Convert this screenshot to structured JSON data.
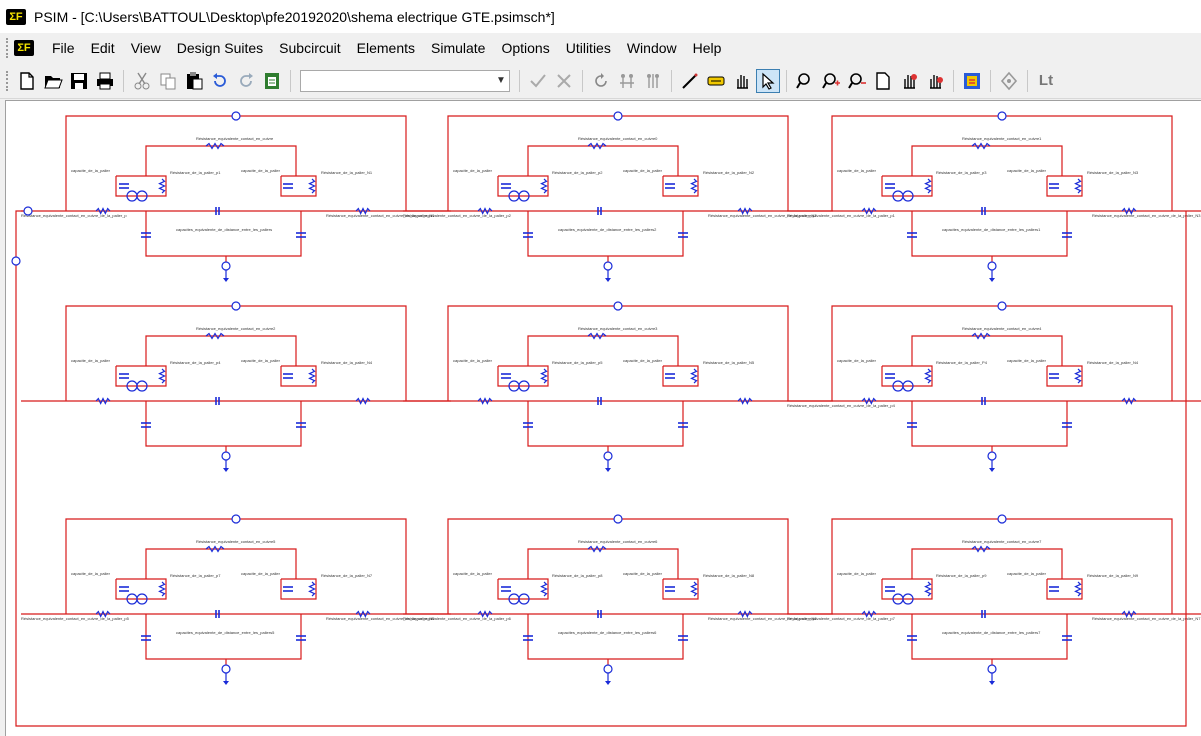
{
  "window": {
    "title": "PSIM - [C:\\Users\\BATTOUL\\Desktop\\pfe20192020\\shema electrique GTE.psimsch*]",
    "logo_text": "ΣF"
  },
  "menu": {
    "items": [
      "File",
      "Edit",
      "View",
      "Design Suites",
      "Subcircuit",
      "Elements",
      "Simulate",
      "Options",
      "Utilities",
      "Window",
      "Help"
    ]
  },
  "toolbar": {
    "combo_value": "",
    "lt_label": "Lt",
    "icons": [
      "new-icon",
      "open-icon",
      "save-icon",
      "print-icon",
      "cut-icon",
      "copy-icon",
      "paste-icon",
      "undo-icon",
      "redo-icon",
      "paste-special-icon",
      "check-icon",
      "cancel-icon",
      "rotate-icon",
      "flip-lr-icon",
      "flip-tb-icon",
      "wire-icon",
      "label-icon",
      "pan-icon",
      "select-icon",
      "zoom-icon",
      "zoom-in-icon",
      "zoom-out-icon",
      "fit-page-icon",
      "element-list-icon",
      "element-count-icon",
      "simcoder-icon",
      "probe-icon"
    ]
  },
  "schematic": {
    "columns": 3,
    "rows": 3,
    "blocks": [
      {
        "top_resistor": "Résistance_equivalente_contact_en_cuivre",
        "cap_left": "capacite_de_la_palier",
        "res_left": "Résistance_de_la_palier_p1",
        "cap_right": "capacite_de_la_palier",
        "res_right": "Résistance_de_la_palier_N1",
        "bottom_cap": "capacites_equivalente_de_distance_entre_les_paliers",
        "left_wire": "Résistance_equivalente_contact_en_cuivre_de_la_palier_p",
        "right_wire": "Résistance_equivalente_contact_en_cuivre_de_la_palier_N1"
      },
      {
        "top_resistor": "Résistance_equivalente_contact_en_cuivre0",
        "cap_left": "capacite_de_la_palier",
        "res_left": "Résistance_de_la_palier_p2",
        "cap_right": "capacite_de_la_palier",
        "res_right": "Résistance_de_la_palier_N2",
        "bottom_cap": "capacites_equivalente_de_distance_entre_les_paliers2",
        "left_wire": "Résistance_equivalente_contact_en_cuivre_de_la_palier_p2",
        "right_wire": "Résistance_equivalente_contact_en_cuivre_de_la_palier_N2"
      },
      {
        "top_resistor": "Résistance_equivalente_contact_en_cuivre1",
        "cap_left": "capacite_de_la_palier",
        "res_left": "Résistance_de_la_palier_p3",
        "cap_right": "capacite_de_la_palier",
        "res_right": "Résistance_de_la_palier_N3",
        "bottom_cap": "capacites_equivalente_de_distance_entre_les_paliers1",
        "left_wire": "Résistance_equivalente_contact_en_cuivre_de_la_palier_p1",
        "right_wire": "Résistance_equivalente_contact_en_cuivre_de_la_palier_N3"
      },
      {
        "top_resistor": "Résistance_equivalente_contact_en_cuivre2",
        "cap_left": "capacite_de_la_palier",
        "res_left": "Résistance_de_la_palier_p4",
        "cap_right": "capacite_de_la_palier",
        "res_right": "Résistance_de_la_palier_N4",
        "bottom_cap": "",
        "left_wire": "",
        "right_wire": ""
      },
      {
        "top_resistor": "Résistance_equivalente_contact_en_cuivre3",
        "cap_left": "capacite_de_la_palier",
        "res_left": "Résistance_de_la_palier_p5",
        "cap_right": "capacite_de_la_palier",
        "res_right": "Résistance_de_la_palier_N5",
        "bottom_cap": "",
        "left_wire": "",
        "right_wire": ""
      },
      {
        "top_resistor": "Résistance_equivalente_contact_en_cuivre4",
        "cap_left": "capacite_de_la_palier",
        "res_left": "Résistance_de_la_palier_P4",
        "cap_right": "capacite_de_la_palier",
        "res_right": "Résistance_de_la_palier_N4",
        "bottom_cap": "",
        "left_wire": "Résistance_equivalente_contact_en_cuivre_de_la_palier_p4",
        "right_wire": ""
      },
      {
        "top_resistor": "Résistance_equivalente_contact_en_cuivre5",
        "cap_left": "capacite_de_la_palier",
        "res_left": "Résistance_de_la_palier_p7",
        "cap_right": "capacite_de_la_palier",
        "res_right": "Résistance_de_la_palier_N7",
        "bottom_cap": "capacites_equivalente_de_distance_entre_les_paliers5",
        "left_wire": "Résistance_equivalente_contact_en_cuivre_de_la_palier_p5",
        "right_wire": "Résistance_equivalente_contact_en_cuivre_de_la_palier_N5"
      },
      {
        "top_resistor": "Résistance_equivalente_contact_en_cuivre6",
        "cap_left": "capacite_de_la_palier",
        "res_left": "Résistance_de_la_palier_p8",
        "cap_right": "capacite_de_la_palier",
        "res_right": "Résistance_de_la_palier_N8",
        "bottom_cap": "capacites_equivalente_de_distance_entre_les_paliers6",
        "left_wire": "Résistance_equivalente_contact_en_cuivre_de_la_palier_p6",
        "right_wire": "Résistance_equivalente_contact_en_cuivre_de_la_palier_N6"
      },
      {
        "top_resistor": "Résistance_equivalente_contact_en_cuivre7",
        "cap_left": "capacite_de_la_palier",
        "res_left": "Résistance_de_la_palier_p9",
        "cap_right": "capacite_de_la_palier",
        "res_right": "Résistance_de_la_palier_N9",
        "bottom_cap": "capacites_equivalente_de_distance_entre_les_paliers7",
        "left_wire": "Résistance_equivalente_contact_en_cuivre_de_la_palier_p7",
        "right_wire": "Résistance_equivalente_contact_en_cuivre_de_la_palier_N7"
      }
    ],
    "colors": {
      "wire": "#d81a1a",
      "component": "#1a2bd8",
      "label": "#333333"
    }
  }
}
